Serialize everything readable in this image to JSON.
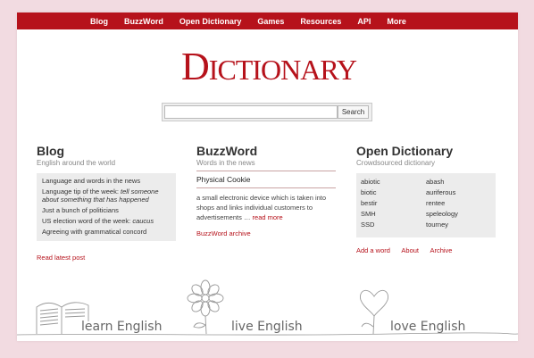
{
  "nav": {
    "items": [
      "Blog",
      "BuzzWord",
      "Open Dictionary",
      "Games",
      "Resources",
      "API",
      "More"
    ]
  },
  "logo": {
    "initial": "D",
    "rest": "ICTIONARY"
  },
  "search": {
    "value": "",
    "button_label": "Search"
  },
  "blog": {
    "title": "Blog",
    "subtitle": "English around the world",
    "items": [
      "Language and words in the news",
      "Language tip of the week: ",
      "Just a bunch of politicians",
      "US election word of the week: ",
      "Agreeing with grammatical concord"
    ],
    "item2_em": "tell someone about something that has happened",
    "item4_em": "caucus",
    "footer_link": "Read latest post"
  },
  "buzzword": {
    "title": "BuzzWord",
    "subtitle": "Words in the news",
    "word": "Physical Cookie",
    "definition": "a small electronic device which is taken into shops and links individual customers to advertisements …",
    "read_more": "read more",
    "archive_link": "BuzzWord archive"
  },
  "open_dictionary": {
    "title": "Open Dictionary",
    "subtitle": "Crowdsourced dictionary",
    "left_words": [
      "abiotic",
      "biotic",
      "bestir",
      "SMH",
      "SSD"
    ],
    "right_words": [
      "abash",
      "auriferous",
      "rentee",
      "speleology",
      "tourney"
    ],
    "links": [
      "Add a word",
      "About",
      "Archive"
    ]
  },
  "footer_art": {
    "captions": [
      "learn English",
      "live English",
      "love English"
    ]
  },
  "colors": {
    "brand_red": "#b6121b",
    "page_bg": "#f2dbe1",
    "box_gray": "#ececec"
  }
}
